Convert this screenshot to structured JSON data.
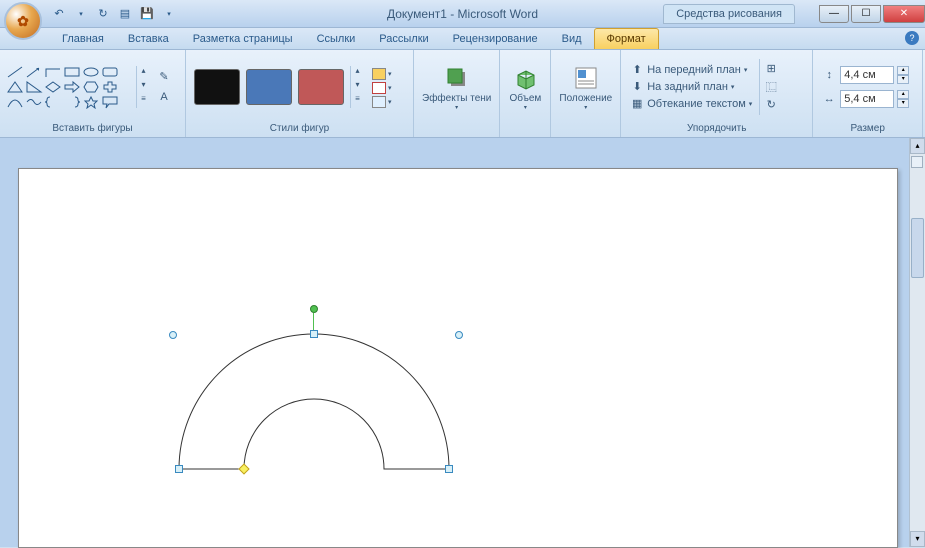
{
  "title": "Документ1 - Microsoft Word",
  "contextual_tab": "Средства рисования",
  "tabs": [
    "Главная",
    "Вставка",
    "Разметка страницы",
    "Ссылки",
    "Рассылки",
    "Рецензирование",
    "Вид",
    "Формат"
  ],
  "active_tab": "Формат",
  "groups": {
    "insert_shapes": "Вставить фигуры",
    "shape_styles": "Стили фигур",
    "shadow_effects": "Эффекты тени",
    "three_d": "Объем",
    "position": "Положение",
    "arrange": "Упорядочить",
    "size": "Размер"
  },
  "arrange": {
    "bring_front": "На передний план",
    "send_back": "На задний план",
    "text_wrap": "Обтекание текстом"
  },
  "size": {
    "height": "4,4 см",
    "width": "5,4 см"
  },
  "qat": {
    "undo": "↶",
    "redo": "↻",
    "save": "💾",
    "new": "▤",
    "dd": "▾"
  }
}
